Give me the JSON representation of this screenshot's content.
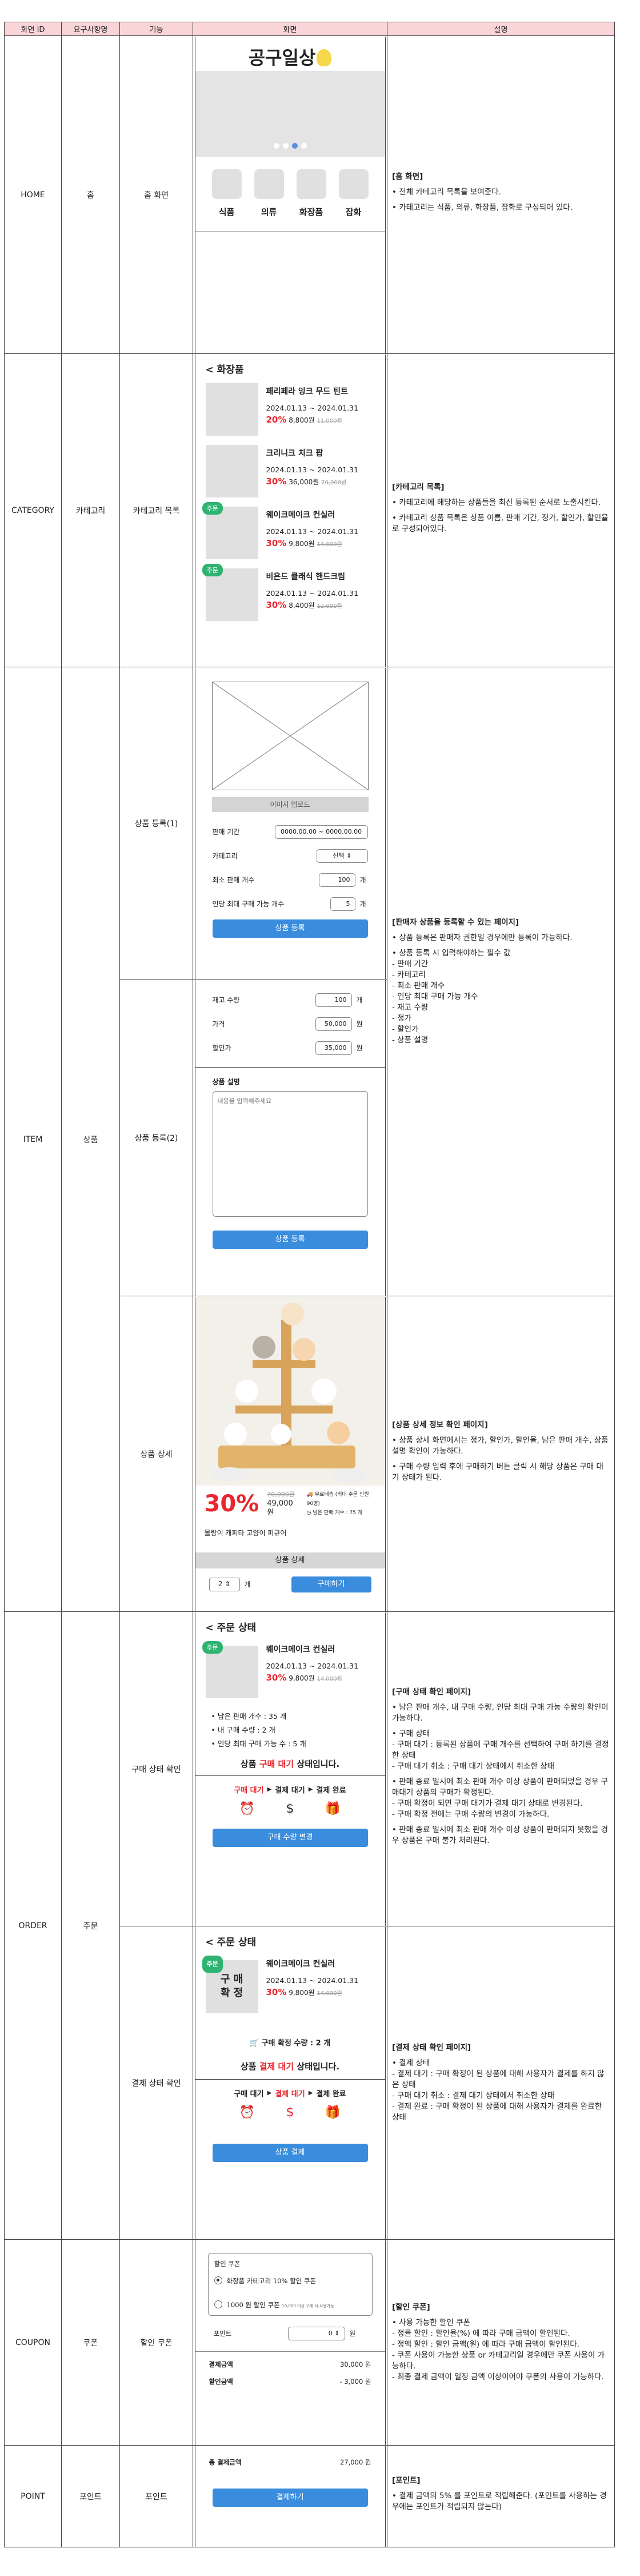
{
  "headers": [
    "화면 ID",
    "요구사항명",
    "기능",
    "화면",
    "설명"
  ],
  "home": {
    "screen_id": "HOME",
    "req": "홈",
    "func": "홈 화면",
    "logo": "공구일상",
    "categories": [
      "식품",
      "의류",
      "화장품",
      "잡화"
    ],
    "desc_title": "[홈 화면]",
    "desc_lines": [
      "• 전체 카테고리 목록을 보여준다.",
      "• 카테고리는 식품, 의류, 화장품, 잡화로 구성되어 있다."
    ]
  },
  "category": {
    "screen_id": "CATEGORY",
    "req": "카테고리",
    "func": "카테고리 목록",
    "back_title": "<  화장품",
    "products": [
      {
        "name": "페리페라 잉크 무드 틴트",
        "date": "2024.01.13 ~ 2024.01.31",
        "pct": "20%",
        "price": "8,800원",
        "orig": "11,000원",
        "badge": ""
      },
      {
        "name": "크리니크 치크 팝",
        "date": "2024.01.13 ~ 2024.01.31",
        "pct": "30%",
        "price": "36,000원",
        "orig": "20,000원",
        "badge": ""
      },
      {
        "name": "웨이크메이크 컨실러",
        "date": "2024.01.13 ~ 2024.01.31",
        "pct": "30%",
        "price": "9,800원",
        "orig": "14,000원",
        "badge": "주문"
      },
      {
        "name": "비욘드 클래식 핸드크림",
        "date": "2024.01.13 ~ 2024.01.31",
        "pct": "30%",
        "price": "8,400원",
        "orig": "12,000원",
        "badge": "주문"
      }
    ],
    "desc_title": "[카테고리 목록]",
    "desc_lines": [
      "• 카테고리에 해당하는 상품들을 최신 등록된 순서로 노출시킨다.",
      "• 카테고리 상품 목록은 상품 이름, 판매 기간, 정가, 할인가, 할인율로 구성되어있다."
    ]
  },
  "item": {
    "screen_id": "ITEM",
    "req": "상품",
    "func1": "상품 등록(1)",
    "func2": "상품 등록(2)",
    "func3": "상품 상세",
    "upload": "이미지 업로드",
    "period_label": "판매 기간",
    "period_value": "0000.00.00 ~ 0000.00.00",
    "cat_label": "카테고리",
    "cat_value": "선택",
    "min_label": "최소 판매 개수",
    "min_value": "100",
    "unit_count": "개",
    "limit_label": "인당 최대 구매 가능 개수",
    "limit_value": "5",
    "register_btn": "상품 등록",
    "stock_label": "재고 수량",
    "stock_value": "100",
    "price_label": "가격",
    "price_value": "50,000",
    "unit_won": "원",
    "sale_label": "할인가",
    "sale_value": "35,000",
    "desc_label": "상품 설명",
    "desc_placeholder": "내용을 입력해주세요",
    "detail_pct": "30%",
    "detail_orig": "70,000원",
    "detail_price": "49,000원",
    "detail_ship": "무료배송 (최대 주문 인원 90명)",
    "detail_remain": "남은 판매 개수 : 75 개",
    "detail_name": "몰랑이 캐피타 고양이 피규어",
    "detail_tab": "상품 상세",
    "qty": "2",
    "buy_btn": "구매하기",
    "desc_title": "[판매자 상품을 등록할 수 있는 페이지]",
    "desc_lines": [
      "• 상품 등록은 판매자 권한일 경우에만 등록이 가능하다.",
      "• 상품 등록 시 입력해야하는 필수 값",
      "- 판매 기간",
      "- 카테고리",
      "- 최소 판매 개수",
      "- 인당 최대 구매 가능 개수",
      "- 재고 수량",
      "- 정가",
      "- 할인가",
      "- 상품 설명"
    ],
    "desc2_title": "[상품 상세 정보 확인 페이지]",
    "desc2_lines": [
      "• 상품 상세 화면에서는 정가, 할인가, 할인율, 남은 판매 개수, 상품 설명 확인이 가능하다.",
      "• 구매 수량 입력 후에 구매하기 버튼 클릭 시 해당 상품은 구매 대기 상태가 된다."
    ]
  },
  "order": {
    "screen_id": "ORDER",
    "req": "주문",
    "func1": "구매 상태 확인",
    "func2": "결제 상태 확인",
    "title": "<  주문 상태",
    "name": "웨이크메이크 컨실러",
    "date": "2024.01.13 ~ 2024.01.31",
    "pct": "30%",
    "price": "9,800원",
    "orig": "14,000원",
    "badge": "주문",
    "b1": "• 남은 판매 개수 : 35 개",
    "b2": "• 내 구매 수량 : 2 개",
    "b3": "• 인당 최대 구매 가능 수 : 5 개",
    "status_pre": "상품 ",
    "status_word": "구매 대기",
    "status_post": " 상태입니다.",
    "steps": [
      "구매 대기",
      "결제 대기",
      "결제 완료"
    ],
    "change_btn": "구매 수량 변경",
    "confirmed": "구 매\n확 정",
    "confirm_qty": "구매 확정 수량 : 2 개",
    "status2_word": "결제 대기",
    "pay_btn": "상품 결제",
    "desc_title": "[구매 상태 확인 페이지]",
    "desc_lines": [
      "• 남은 판매 개수, 내 구매 수량, 인당 최대 구매 가능 수량의 확인이 가능하다.",
      "• 구매 상태",
      "- 구매 대기 : 등록된 상품에 구매 개수를 선택하여 구매 하기를 결정한 상태",
      "- 구매 대기 취소 : 구매 대기 상태에서 취소한 상태",
      "• 판매 종료 일시에 최소 판매 개수 이상 상품이 판매되었을 경우 구매대기 상품의 구매가 확정된다.",
      "- 구매 확정이 되면 구매 대기가 결제 대기 상태로 변경된다.",
      "- 구매 확정 전에는 구매 수량의 변경이 가능하다.",
      "• 판매 종료 일시에 최소 판매 개수 이상 상품이 판매되지 못했을 경우 상품은 구매 불가 처리된다."
    ],
    "desc2_title": "[결제 상태 확인 페이지]",
    "desc2_lines": [
      "• 결제 상태",
      "- 결제 대기 : 구매 확정이 된 상품에 대해 사용자가 결제를 하지 않은 상태",
      "- 구매 대기 취소 : 결제 대기 상태에서 취소한 상태",
      "- 결제 완료 : 구매 확정이 된 상품에 대해 사용자가 결제를 완료한 상태"
    ]
  },
  "coupon": {
    "screen_id": "COUPON",
    "req": "쿠폰",
    "func": "할인 쿠폰",
    "label": "할인 쿠폰",
    "opt1": "화장품 카테고리 10% 할인 쿠폰",
    "opt2": "1000 원 할인 쿠폰",
    "opt2_note": "10,000 이상 구매 시 사용가능",
    "point_label": "포인트",
    "point_value": "0",
    "unit_won": "원",
    "total_label": "결제금액",
    "total_value": "30,000 원",
    "disc_label": "할인금액",
    "disc_value": "- 3,000 원",
    "desc_title": "[할인 쿠폰]",
    "desc_lines": [
      "• 사용 가능한 할인 쿠폰",
      "- 정률 할인 : 할인율(%) 에 따라 구매 금액이 할인된다.",
      "- 정액 할인 : 할인 금액(원) 에 따라 구매 금액이 할인된다.",
      "- 쿠폰 사용이 가능한 상품 or 카테고리일 경우에만 쿠폰 사용이 가능하다.",
      "- 최종 결제 금액이 일정 금액 이상이어야 쿠폰의 사용이 가능하다."
    ]
  },
  "point": {
    "screen_id": "POINT",
    "req": "포인트",
    "func": "포인트",
    "final_label": "총 결제금액",
    "final_value": "27,000 원",
    "pay_btn": "결제하기",
    "desc_title": "[포인트]",
    "desc_lines": [
      "• 결제 금액의 5% 를 포인트로 적립해준다. (포인트를 사용하는 경우에는 포인트가 적립되지 않는다)"
    ]
  }
}
